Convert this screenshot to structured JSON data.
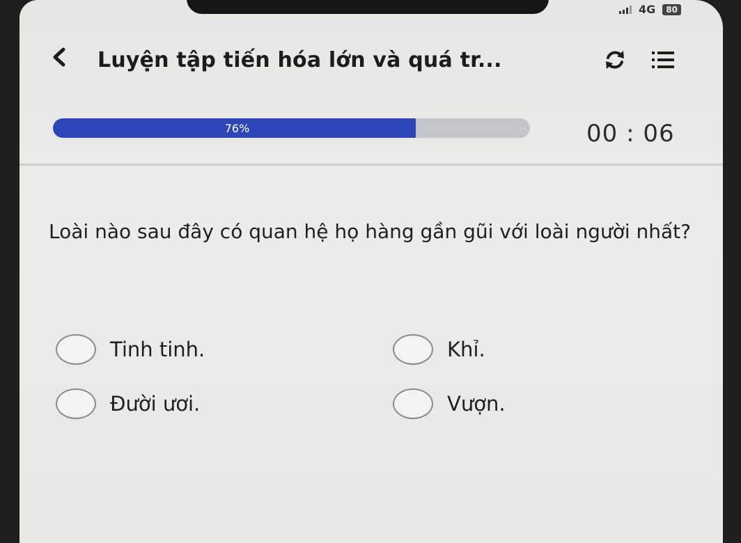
{
  "status_bar": {
    "network": "4G",
    "battery": "80"
  },
  "header": {
    "title": "Luyện tập tiến hóa lớn và quá tr...",
    "back_icon": "chevron-left-icon",
    "refresh_icon": "refresh-icon",
    "menu_icon": "list-menu-icon"
  },
  "progress": {
    "value": 0.76,
    "label": "76%",
    "fill_color": "#2c46b8"
  },
  "timer": "00 : 06",
  "question": {
    "text": "Loài nào sau đây có quan hệ họ hàng gần gũi với loài người nhất?",
    "options": [
      {
        "label": "Tinh tinh."
      },
      {
        "label": "Khỉ."
      },
      {
        "label": "Đười ươi."
      },
      {
        "label": "Vượn."
      }
    ]
  }
}
